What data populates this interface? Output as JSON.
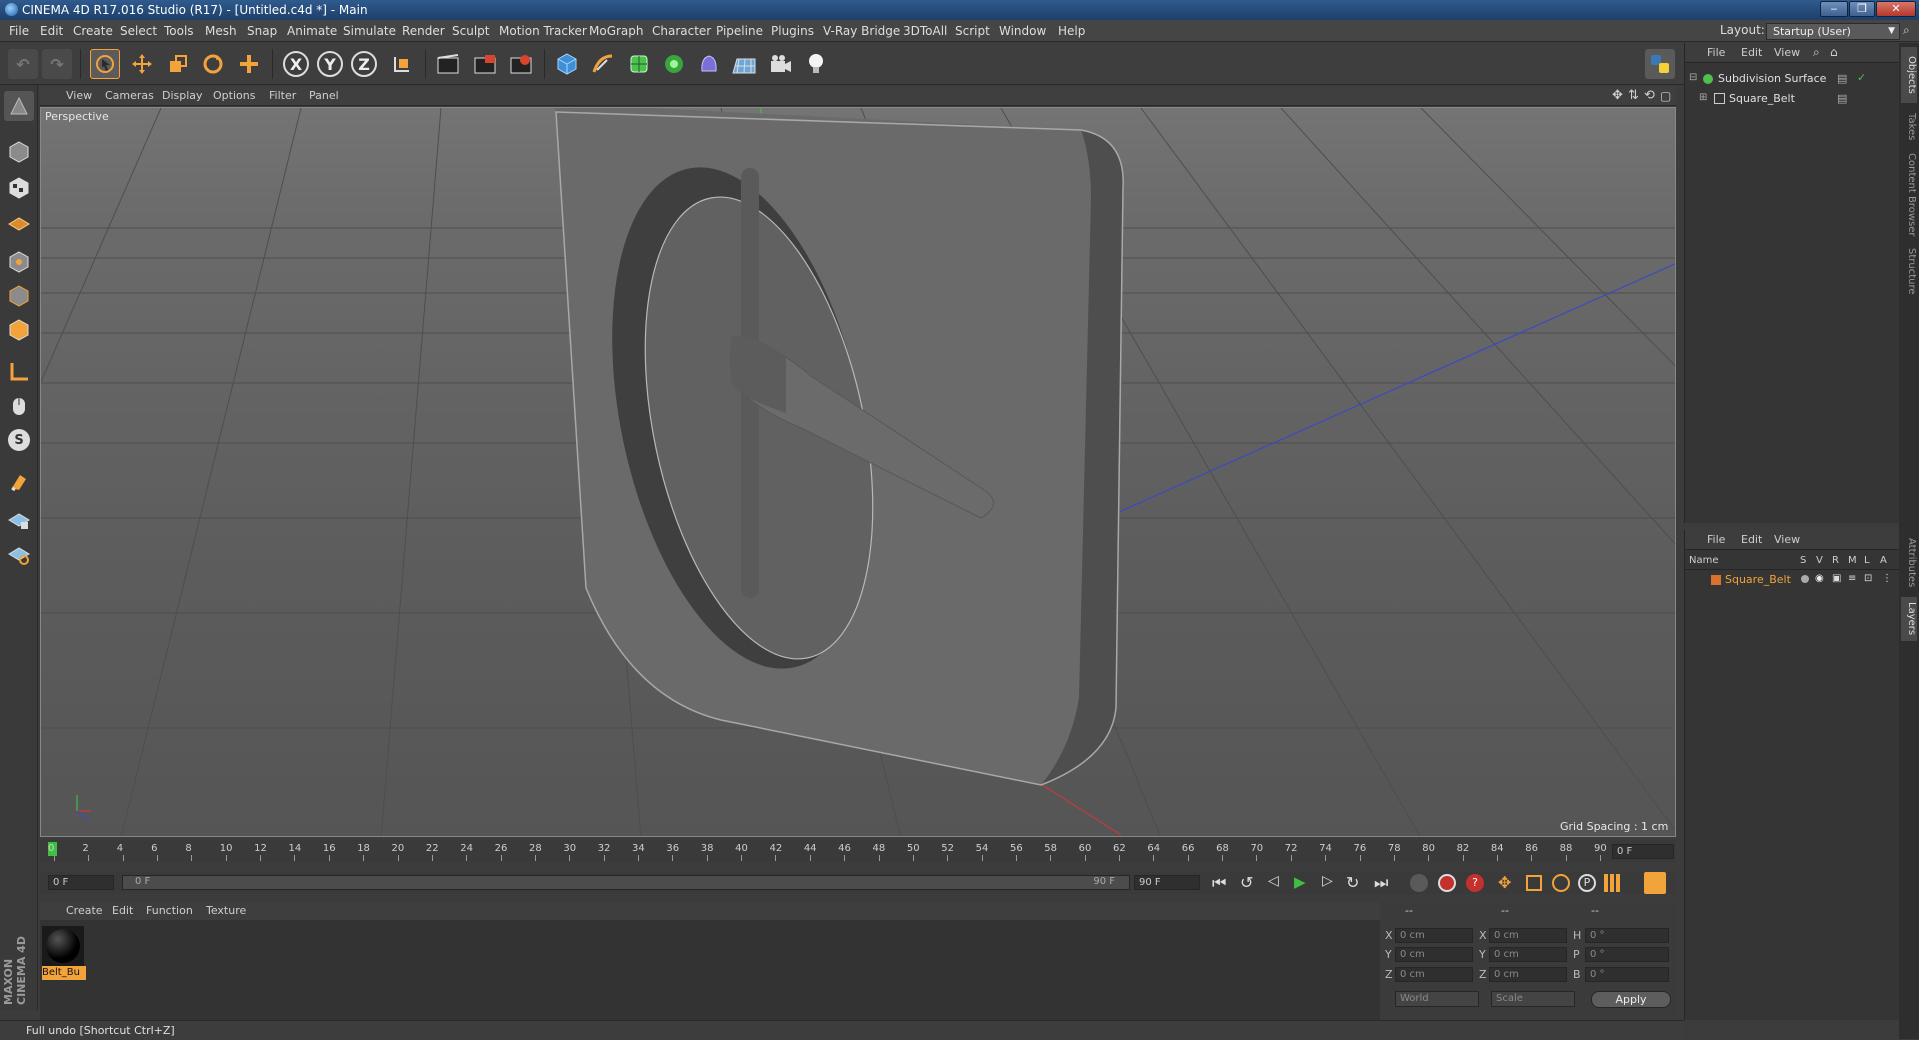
{
  "window": {
    "title": "CINEMA 4D R17.016 Studio (R17) - [Untitled.c4d *] - Main",
    "controls": [
      "‒",
      "❐",
      "✕"
    ]
  },
  "menu": [
    "File",
    "Edit",
    "Create",
    "Select",
    "Tools",
    "Mesh",
    "Snap",
    "Animate",
    "Simulate",
    "Render",
    "Sculpt",
    "Motion Tracker",
    "MoGraph",
    "Character",
    "Pipeline",
    "Plugins",
    "V-Ray Bridge",
    "3DToAll",
    "Script",
    "Window",
    "Help"
  ],
  "layout": {
    "label": "Layout:",
    "value": "Startup (User)"
  },
  "toolbar_icons": [
    "undo-icon",
    "redo-icon",
    "live-selection-icon",
    "move-icon",
    "scale-icon",
    "rotate-icon",
    "add-object-icon",
    "x-axis-icon",
    "y-axis-icon",
    "z-axis-icon",
    "coordinate-system-icon",
    "render-view-icon",
    "render-picture-viewer-icon",
    "edit-render-settings-icon",
    "cube-icon",
    "pen-spline-icon",
    "subdivision-icon",
    "array-icon",
    "deformer-icon",
    "floor-icon",
    "camera-icon",
    "light-icon",
    "python-icon"
  ],
  "toolbar_axis_labels": {
    "x": "X",
    "y": "Y",
    "z": "Z"
  },
  "left_tool_labels": {
    "s": "S"
  },
  "viewport": {
    "menu": [
      "View",
      "Cameras",
      "Display",
      "Options",
      "Filter",
      "Panel"
    ],
    "label": "Perspective",
    "grid_spacing": "Grid Spacing : 1 cm"
  },
  "timeline": {
    "ticks": [
      "0",
      "2",
      "4",
      "6",
      "8",
      "10",
      "12",
      "14",
      "16",
      "18",
      "20",
      "22",
      "24",
      "26",
      "28",
      "30",
      "32",
      "34",
      "36",
      "38",
      "40",
      "42",
      "44",
      "46",
      "48",
      "50",
      "52",
      "54",
      "56",
      "58",
      "60",
      "62",
      "64",
      "66",
      "68",
      "70",
      "72",
      "74",
      "76",
      "78",
      "80",
      "82",
      "84",
      "86",
      "88",
      "90"
    ],
    "current": "0 F",
    "start": "0 F",
    "range_start": "0 F",
    "range_end": "90 F",
    "end": "90 F"
  },
  "materials": {
    "menu": [
      "Create",
      "Edit",
      "Function",
      "Texture"
    ],
    "items": [
      {
        "name": "Belt_Bu"
      }
    ]
  },
  "coordinates": {
    "headers": [
      "--",
      "--",
      "--"
    ],
    "rows": [
      {
        "a": "X",
        "av": "0 cm",
        "b": "X",
        "bv": "0 cm",
        "c": "H",
        "cv": "0 °"
      },
      {
        "a": "Y",
        "av": "0 cm",
        "b": "Y",
        "bv": "0 cm",
        "c": "P",
        "cv": "0 °"
      },
      {
        "a": "Z",
        "av": "0 cm",
        "b": "Z",
        "bv": "0 cm",
        "c": "B",
        "cv": "0 °"
      }
    ],
    "mode": "World",
    "type": "Scale",
    "apply": "Apply"
  },
  "objects_panel": {
    "menu": [
      "File",
      "Edit",
      "View"
    ],
    "items": [
      {
        "name": "Subdivision Surface"
      },
      {
        "name": "Square_Belt"
      }
    ]
  },
  "layers_panel": {
    "menu": [
      "File",
      "Edit",
      "View"
    ],
    "headers": [
      "Name",
      "S",
      "V",
      "R",
      "M",
      "L",
      "A"
    ],
    "items": [
      {
        "name": "Square_Belt"
      }
    ]
  },
  "side_tabs": [
    "Objects",
    "Takes",
    "Content Browser",
    "Structure",
    "Attributes",
    "Layers"
  ],
  "status": "Full undo [Shortcut Ctrl+Z]",
  "brand": "MAXON CINEMA 4D",
  "colors": {
    "accent": "#f2a33a",
    "selection": "#e8a13a",
    "axis_x": "#c43b3b",
    "axis_y": "#3fbf3f",
    "axis_z": "#3b49c4"
  }
}
